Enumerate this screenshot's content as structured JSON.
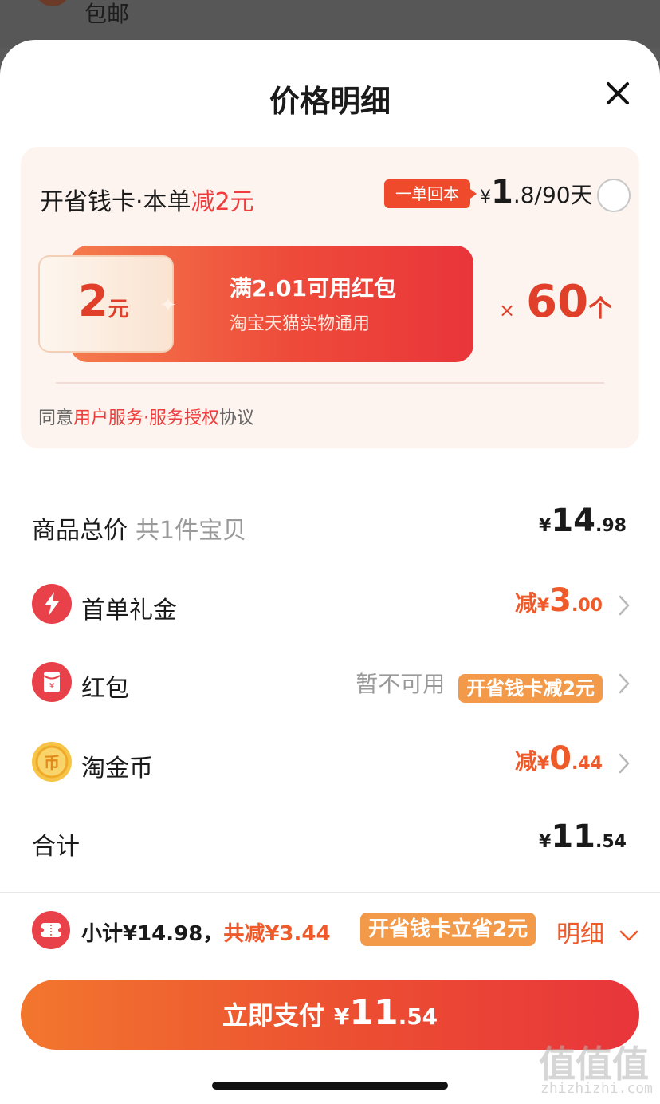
{
  "background": {
    "peek_text": "包邮"
  },
  "sheet": {
    "title": "价格明细"
  },
  "card": {
    "title_prefix": "开省钱卡·本单",
    "title_highlight": "减2元",
    "badge": "一单回本",
    "price_currency": "¥",
    "price_int": "1",
    "price_rest": ".8/90天",
    "coupon_amount": "2",
    "coupon_unit": "元",
    "coupon_title": "满2.01可用红包",
    "coupon_desc": "淘宝天猫实物通用",
    "qty_prefix": "×",
    "qty_number": "60",
    "qty_unit": "个",
    "agreement_prefix": "同意",
    "agreement_link1": "用户服务",
    "agreement_dot": "·",
    "agreement_link2": "服务授权",
    "agreement_suffix": "协议",
    "accent_color": "#ee3b3b"
  },
  "rows": {
    "total": {
      "label": "商品总价",
      "sub": "共1件宝贝",
      "currency": "¥",
      "int": "14",
      "dec": ".98"
    },
    "gift": {
      "label": "首单礼金",
      "prefix": "减",
      "currency": "¥",
      "int": "3",
      "dec": ".00",
      "icon": "lightning-icon"
    },
    "hongbao": {
      "label": "红包",
      "status": "暂不可用",
      "badge": "开省钱卡减2元",
      "icon": "red-envelope-icon"
    },
    "coin": {
      "label": "淘金币",
      "prefix": "减",
      "currency": "¥",
      "int": "0",
      "dec": ".44",
      "icon": "coin-icon"
    },
    "sum": {
      "label": "合计",
      "currency": "¥",
      "int": "11",
      "dec": ".54"
    }
  },
  "footer": {
    "subtotal": "小计¥14.98，",
    "saved": "共减¥3.44",
    "badge": "开省钱卡立省2元",
    "detail": "明细",
    "pay_label": "立即支付",
    "pay_currency": "¥",
    "pay_int": "11",
    "pay_dec": ".54",
    "brand_color": "#ef5a2b"
  },
  "watermark": {
    "text": "值值值",
    "url": "zhizhizhi.com"
  }
}
